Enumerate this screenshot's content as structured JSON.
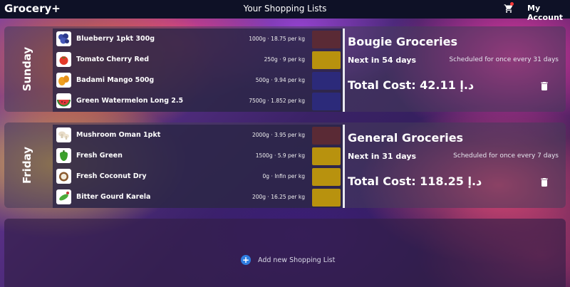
{
  "app": {
    "brand": "Grocery+",
    "title": "Your Shopping Lists",
    "account_label": "My Account"
  },
  "colors": {
    "topbar": "#0e1126",
    "accent": "#2f7de0"
  },
  "lists": [
    {
      "day": "Sunday",
      "name": "Bougie Groceries",
      "next": "Next in 54 days",
      "schedule": "Scheduled for once every 31 days",
      "total": "Total Cost: 42.11 د.إ",
      "items": [
        {
          "name": "Blueberry 1pkt 300g",
          "qty": "1000g · 18.75 per kg",
          "color": "#5a2a35",
          "icon": "blueberry-icon"
        },
        {
          "name": "Tomato Cherry Red",
          "qty": "250g · 9 per kg",
          "color": "#b8920e",
          "icon": "tomato-icon"
        },
        {
          "name": "Badami Mango 500g",
          "qty": "500g · 9.94 per kg",
          "color": "#2c2a7a",
          "icon": "mango-icon"
        },
        {
          "name": "Green Watermelon Long 2.5",
          "qty": "7500g · 1.852 per kg",
          "color": "#2c2a7a",
          "icon": "watermelon-icon"
        }
      ]
    },
    {
      "day": "Friday",
      "name": "General Groceries",
      "next": "Next in 31 days",
      "schedule": "Scheduled for once every 7 days",
      "total": "Total Cost: 118.25 د.إ",
      "items": [
        {
          "name": "Mushroom Oman 1pkt",
          "qty": "2000g · 3.95 per kg",
          "color": "#5a2a35",
          "icon": "mushroom-icon"
        },
        {
          "name": "Fresh Green",
          "qty": "1500g · 5.9 per kg",
          "color": "#b8920e",
          "icon": "pepper-icon"
        },
        {
          "name": "Fresh Coconut Dry",
          "qty": "0g · Infin per kg",
          "color": "#b8920e",
          "icon": "coconut-icon"
        },
        {
          "name": "Bitter Gourd Karela",
          "qty": "200g · 16.25 per kg",
          "color": "#b8920e",
          "icon": "bitter-gourd-icon"
        }
      ]
    }
  ],
  "add_list": {
    "label": "Add new Shopping List"
  }
}
